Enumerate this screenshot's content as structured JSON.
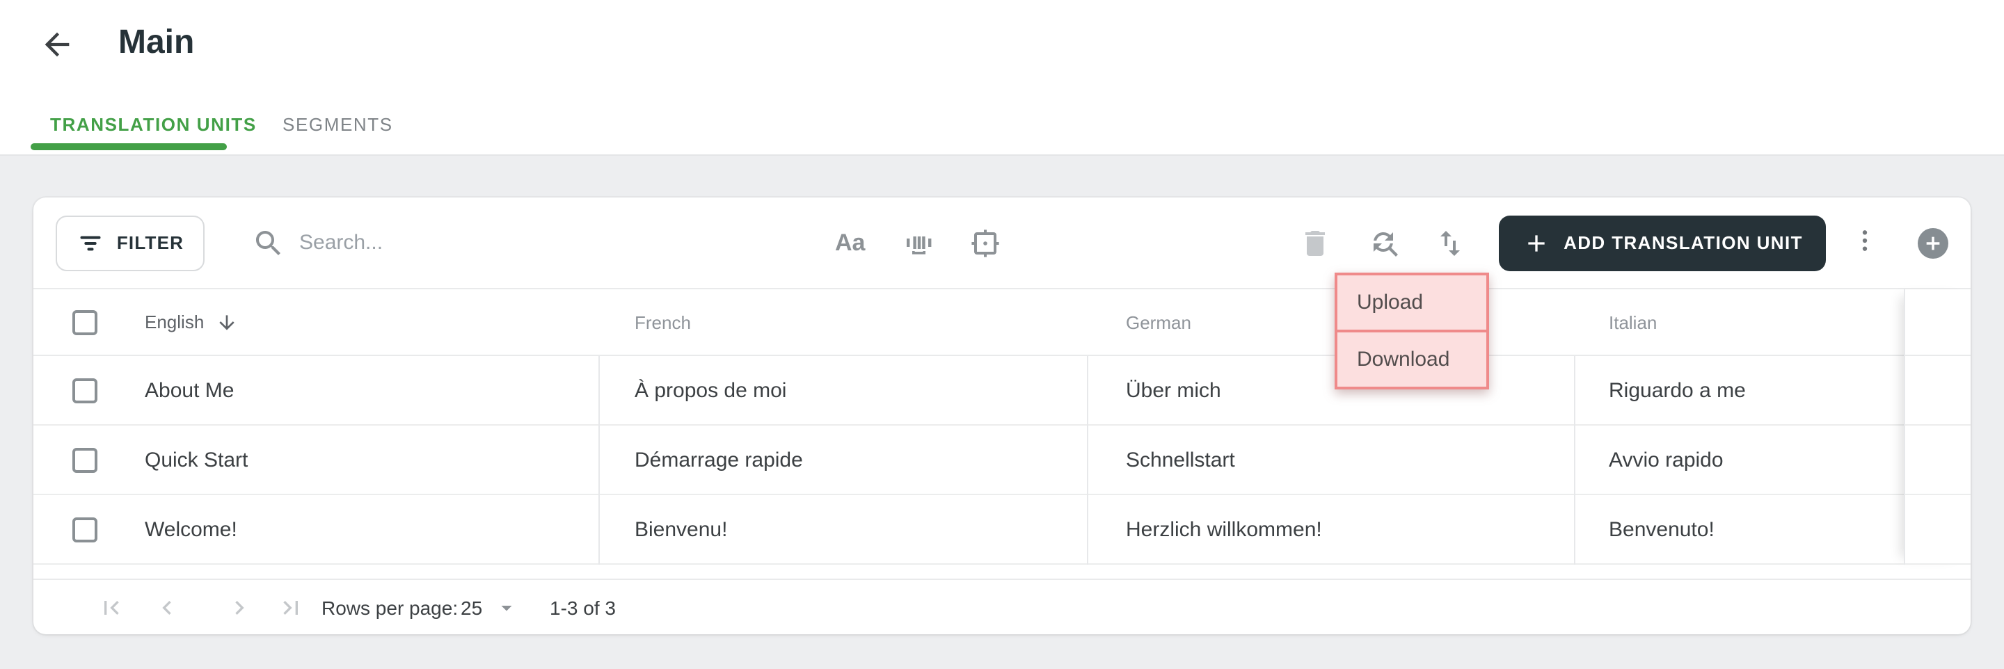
{
  "header": {
    "title": "Main",
    "tabs": [
      {
        "label": "TRANSLATION UNITS",
        "active": true
      },
      {
        "label": "SEGMENTS",
        "active": false
      }
    ]
  },
  "toolbar": {
    "filter_label": "FILTER",
    "search_placeholder": "Search...",
    "match_case_label": "Aa",
    "add_button_label": "ADD TRANSLATION UNIT",
    "icons": [
      "filter-icon",
      "search-icon",
      "match-case-icon",
      "barcode-icon",
      "center-focus-icon",
      "trash-icon",
      "find-replace-icon",
      "import-export-icon",
      "plus-icon",
      "kebab-menu-icon",
      "circle-plus-icon"
    ]
  },
  "menu": {
    "items": [
      "Upload",
      "Download"
    ],
    "highlight_background": "#fcdfdf",
    "highlight_border": "#ef8a8a"
  },
  "table": {
    "columns": [
      "English",
      "French",
      "German",
      "Italian"
    ],
    "sort_column": "English",
    "sort_direction": "desc",
    "rows": [
      [
        "About Me",
        "À propos de moi",
        "Über mich",
        "Riguardo a me"
      ],
      [
        "Quick Start",
        "Démarrage rapide",
        "Schnellstart",
        "Avvio rapido"
      ],
      [
        "Welcome!",
        "Bienvenu!",
        "Herzlich willkommen!",
        "Benvenuto!"
      ]
    ]
  },
  "pagination": {
    "rows_per_page_label": "Rows per page:",
    "rows_per_page_value": "25",
    "range_label": "1-3 of 3"
  },
  "colors": {
    "accent_green": "#43a047",
    "primary_button": "#263238",
    "page_background": "#edeef0",
    "icon_gray": "#8d9296",
    "disabled_icon": "#c5c8cb",
    "row_text": "#3c4043",
    "header_text": "#8f949a"
  }
}
